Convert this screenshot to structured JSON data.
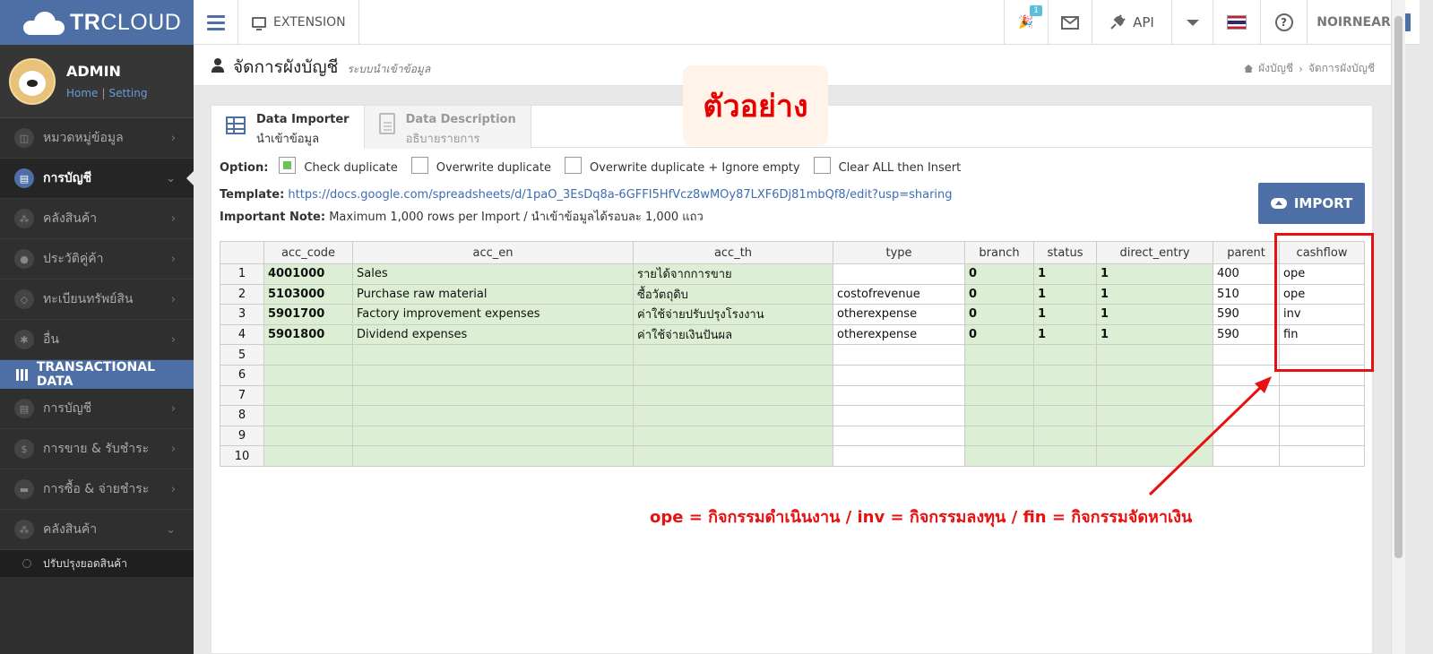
{
  "app": {
    "logo_bold": "TR",
    "logo_rest": "CLOUD",
    "extension_label": "EXTENSION",
    "notification_badge": "1",
    "api_label": "API",
    "user_label": "NOIRNEAR"
  },
  "sidebar": {
    "admin_name": "ADMIN",
    "home_link": "Home",
    "separator": "|",
    "setting_link": "Setting",
    "items": [
      {
        "label": "หมวดหมู่ข้อมูล",
        "chev": "›"
      },
      {
        "label": "การบัญชี",
        "chev": "⌄"
      },
      {
        "label": "คลังสินค้า",
        "chev": "›"
      },
      {
        "label": "ประวัติคู่ค้า",
        "chev": "›"
      },
      {
        "label": "ทะเบียนทรัพย์สิน",
        "chev": "›"
      },
      {
        "label": "อื่น",
        "chev": "›"
      }
    ],
    "section_title": "TRANSACTIONAL DATA",
    "items2": [
      {
        "label": "การบัญชี",
        "chev": "›"
      },
      {
        "label": "การขาย & รับชำระ",
        "chev": "›"
      },
      {
        "label": "การซื้อ & จ่ายชำระ",
        "chev": "›"
      },
      {
        "label": "คลังสินค้า",
        "chev": "⌄"
      }
    ],
    "submenu_item": "ปรับปรุงยอดสินค้า"
  },
  "page": {
    "title": "จัดการผังบัญชี",
    "subtitle": "ระบบนำเข้าข้อมูล",
    "breadcrumb": [
      "ผังบัญชี",
      "›",
      "จัดการผังบัญชี"
    ]
  },
  "example_label": "ตัวอย่าง",
  "tabs": [
    {
      "title": "Data Importer",
      "subtitle": "นำเข้าข้อมูล"
    },
    {
      "title": "Data Description",
      "subtitle": "อธิบายรายการ"
    }
  ],
  "options": {
    "label": "Option:",
    "items": [
      {
        "label": "Check duplicate",
        "checked": true
      },
      {
        "label": "Overwrite duplicate",
        "checked": false
      },
      {
        "label": "Overwrite duplicate + Ignore empty",
        "checked": false
      },
      {
        "label": "Clear ALL then Insert",
        "checked": false
      }
    ]
  },
  "template": {
    "label": "Template:",
    "url": "https://docs.google.com/spreadsheets/d/1paO_3EsDq8a-6GFFI5HfVcz8wMOy87LXF6Dj81mbQf8/edit?usp=sharing"
  },
  "note": {
    "label": "Important Note:",
    "text": "Maximum 1,000 rows per Import / นำเข้าข้อมูลได้รอบละ 1,000 แถว"
  },
  "import_button": "IMPORT",
  "grid": {
    "columns": [
      "",
      "acc_code",
      "acc_en",
      "acc_th",
      "type",
      "branch",
      "status",
      "direct_entry",
      "parent",
      "cashflow"
    ],
    "rows": [
      [
        "1",
        "4001000",
        "Sales",
        "รายได้จากการขาย",
        "",
        "0",
        "1",
        "1",
        "400",
        "ope"
      ],
      [
        "2",
        "5103000",
        "Purchase raw material",
        "ซื้อวัตถุดิบ",
        "costofrevenue",
        "0",
        "1",
        "1",
        "510",
        "ope"
      ],
      [
        "3",
        "5901700",
        "Factory improvement expenses",
        "ค่าใช้จ่ายปรับปรุงโรงงาน",
        "otherexpense",
        "0",
        "1",
        "1",
        "590",
        "inv"
      ],
      [
        "4",
        "5901800",
        "Dividend expenses",
        "ค่าใช้จ่ายเงินปันผล",
        "otherexpense",
        "0",
        "1",
        "1",
        "590",
        "fin"
      ],
      [
        "5",
        "",
        "",
        "",
        "",
        "",
        "",
        "",
        "",
        ""
      ],
      [
        "6",
        "",
        "",
        "",
        "",
        "",
        "",
        "",
        "",
        ""
      ],
      [
        "7",
        "",
        "",
        "",
        "",
        "",
        "",
        "",
        "",
        ""
      ],
      [
        "8",
        "",
        "",
        "",
        "",
        "",
        "",
        "",
        "",
        ""
      ],
      [
        "9",
        "",
        "",
        "",
        "",
        "",
        "",
        "",
        "",
        ""
      ],
      [
        "10",
        "",
        "",
        "",
        "",
        "",
        "",
        "",
        "",
        ""
      ]
    ]
  },
  "legend": "ope = กิจกรรมดำเนินงาน / inv = กิจกรรมลงทุน / fin = กิจกรรมจัดหาเงิน",
  "colors": {
    "brand": "#4d6fa5",
    "highlight_red": "#e81010",
    "green_cell": "#dcefd5"
  }
}
